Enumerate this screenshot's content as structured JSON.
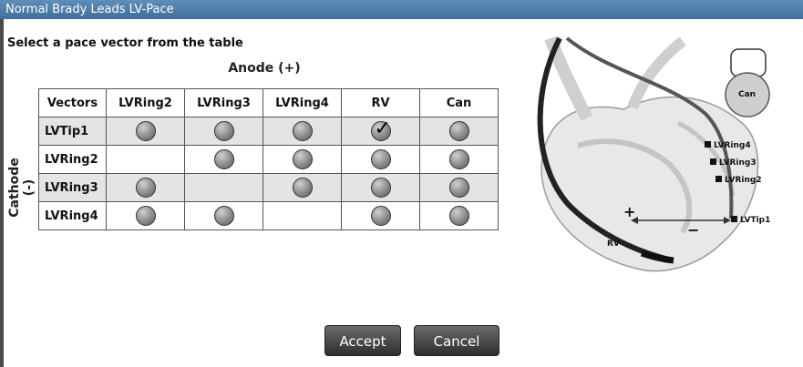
{
  "window": {
    "title": "Normal Brady Leads LV-Pace"
  },
  "instruction": "Select a pace vector from the table",
  "anode_title": "Anode (+)",
  "cathode_label": "Cathode (-)",
  "table": {
    "header": {
      "vectors": "Vectors",
      "columns": [
        "LVRing2",
        "LVRing3",
        "LVRing4",
        "RV",
        "Can"
      ]
    },
    "rows": [
      {
        "label": "LVTip1",
        "cells": [
          "radio",
          "radio",
          "radio",
          "radio-checked",
          "radio"
        ]
      },
      {
        "label": "LVRing2",
        "cells": [
          "",
          "radio",
          "radio",
          "radio",
          "radio"
        ]
      },
      {
        "label": "LVRing3",
        "cells": [
          "radio",
          "",
          "radio",
          "radio",
          "radio"
        ]
      },
      {
        "label": "LVRing4",
        "cells": [
          "radio",
          "radio",
          "",
          "radio",
          "radio"
        ]
      }
    ],
    "selected": {
      "row": "LVTip1",
      "column": "RV"
    }
  },
  "buttons": {
    "accept": "Accept",
    "cancel": "Cancel"
  },
  "diagram": {
    "can_label": "Can",
    "electrodes": [
      "LVRing4",
      "LVRing3",
      "LVRing2",
      "LVTip1"
    ],
    "rv_label": "RV",
    "plus_sign": "+",
    "minus_sign": "−"
  }
}
